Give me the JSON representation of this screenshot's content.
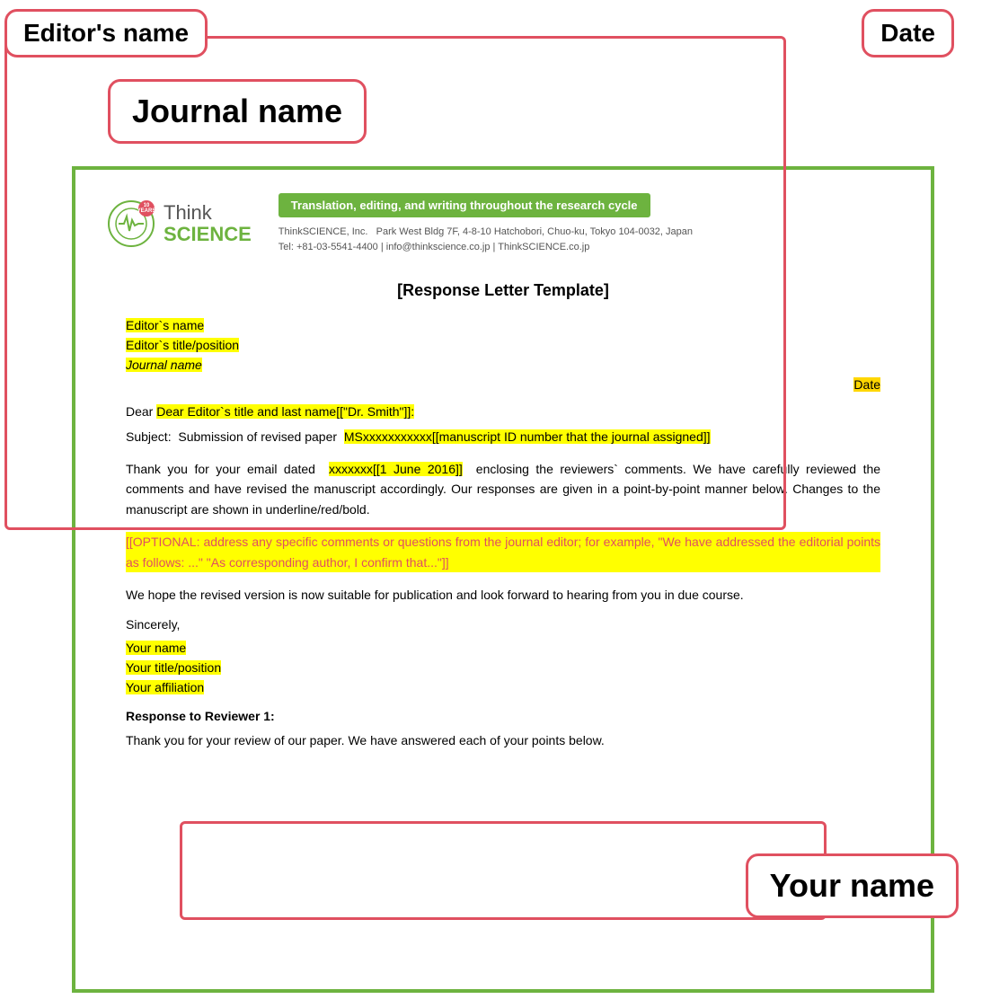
{
  "callouts": {
    "editors_name": "Editor's name",
    "date": "Date",
    "journal_name": "Journal name",
    "your_name": "Your name"
  },
  "header": {
    "logo_years": "10",
    "logo_years_label": "YEARS",
    "logo_think": "Think",
    "logo_science": "SCIENCE",
    "tagline": "Translation, editing, and writing throughout the research cycle",
    "company": "ThinkSCIENCE, Inc.",
    "address": "Park West Bldg 7F, 4-8-10 Hatchobori, Chuo-ku, Tokyo 104-0032, Japan",
    "tel": "Tel: +81-03-5541-4400 | info@thinkscience.co.jp | ThinkSCIENCE.co.jp"
  },
  "document": {
    "title": "[Response Letter Template]",
    "editor_name_field": "Editor`s name",
    "editor_title_field": "Editor`s title/position",
    "journal_name_field": "Journal name",
    "date_field": "Date",
    "dear_line": "Dear Editor`s title and last name[[\"Dr. Smith\"]]:",
    "subject_label": "Subject:",
    "subject_text": "Submission of revised paper",
    "manuscript_id": "MSxxxxxxxxxxx[[manuscript ID number that the journal assigned]]",
    "body1": "Thank you for your email dated",
    "date_placeholder": "xxxxxxx[[1 June 2016]]",
    "body1_cont": "enclosing the reviewers` comments. We have carefully reviewed the comments and have revised the manuscript accordingly. Our responses are given in a point-by-point manner below. Changes to the manuscript are shown in underline/red/bold.",
    "optional": "[[OPTIONAL: address any specific comments or questions from the journal editor; for example, \"We have addressed the editorial points as follows: ...\" \"As corresponding author, I confirm that...\"]]",
    "hope_text": "We hope the revised version is now suitable for publication and look forward to hearing from you in due course.",
    "sincerely": "Sincerely,",
    "your_name": "Your name",
    "your_title": "Your title/position",
    "your_affiliation": "Your affiliation",
    "response_header": "Response to Reviewer 1:",
    "response_text": "Thank you for your review of our paper. We have answered each of your points below."
  }
}
